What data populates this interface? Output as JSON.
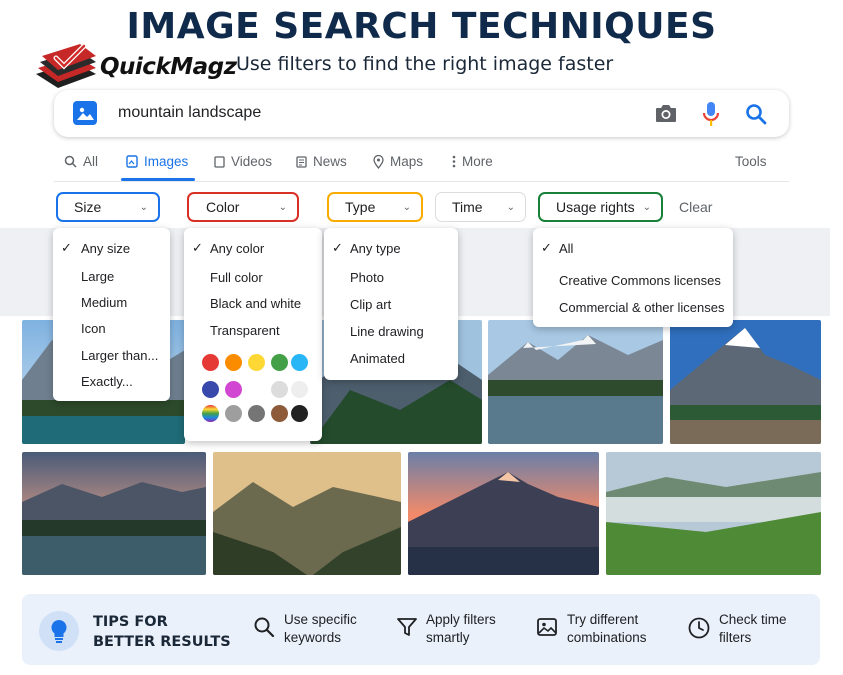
{
  "header": {
    "title": "IMAGE SEARCH TECHNIQUES",
    "brand": "QuickMagz",
    "subtitle": "Use filters to find the right image faster"
  },
  "search": {
    "query": "mountain landscape",
    "icons": [
      "image-search-icon",
      "camera-icon",
      "microphone-icon",
      "search-icon"
    ]
  },
  "tabs": [
    {
      "label": "All",
      "icon": "search-icon"
    },
    {
      "label": "Images",
      "icon": "image-icon",
      "active": true
    },
    {
      "label": "Videos",
      "icon": "video-icon"
    },
    {
      "label": "News",
      "icon": "news-icon"
    },
    {
      "label": "Maps",
      "icon": "map-pin-icon"
    },
    {
      "label": "More",
      "icon": "more-vert-icon"
    }
  ],
  "tools_label": "Tools",
  "filters": [
    {
      "label": "Size",
      "color": "#1a73e8"
    },
    {
      "label": "Color",
      "color": "#d93025"
    },
    {
      "label": "Type",
      "color": "#f9ab00"
    },
    {
      "label": "Time",
      "color": "#dadce0"
    },
    {
      "label": "Usage rights",
      "color": "#188038"
    }
  ],
  "clear_label": "Clear",
  "menus": {
    "size": {
      "selected": "Any size",
      "options": [
        "Large",
        "Medium",
        "Icon",
        "Larger than...",
        "Exactly..."
      ]
    },
    "color": {
      "selected": "Any color",
      "options": [
        "Full color",
        "Black and white",
        "Transparent"
      ],
      "swatches": [
        "#e53935",
        "#fb8c00",
        "#fdd835",
        "#43a047",
        "#29b6f6",
        "#3949ab",
        "#d147d1",
        "#ffffff",
        "#dcdcdc",
        "#eeeeee",
        "rainbow",
        "#9e9e9e",
        "#757575",
        "#8d5b3a",
        "#222222"
      ]
    },
    "type": {
      "selected": "Any type",
      "options": [
        "Photo",
        "Clip art",
        "Line drawing",
        "Animated"
      ]
    },
    "usage": {
      "selected": "All",
      "options": [
        "Creative Commons licenses",
        "Commercial & other licenses"
      ]
    }
  },
  "tips": {
    "title": "TIPS FOR BETTER RESULTS",
    "items": [
      {
        "text": "Use specific keywords",
        "icon": "search-icon"
      },
      {
        "text": "Apply filters smartly",
        "icon": "filter-icon"
      },
      {
        "text": "Try different combinations",
        "icon": "image-icon"
      },
      {
        "text": "Check time filters",
        "icon": "clock-icon"
      }
    ]
  }
}
